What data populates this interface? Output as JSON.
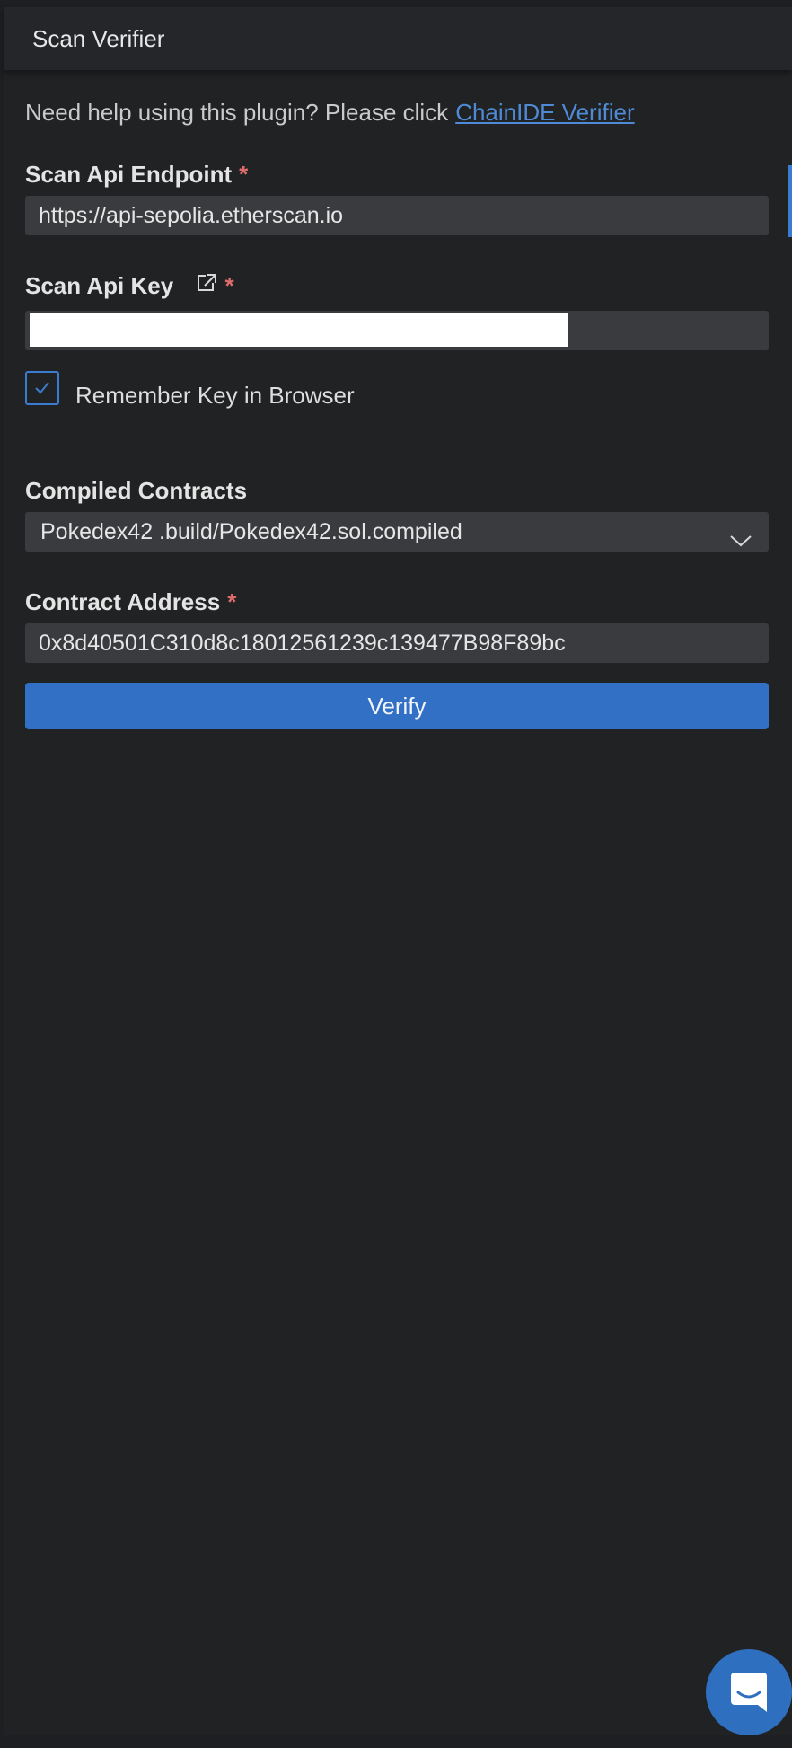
{
  "header": {
    "title": "Scan Verifier"
  },
  "help": {
    "text": "Need help using this plugin? Please click",
    "link_label": "ChainIDE Verifier"
  },
  "endpoint": {
    "label": "Scan Api Endpoint",
    "required_mark": "*",
    "value": "https://api-sepolia.etherscan.io"
  },
  "api_key": {
    "label": "Scan Api Key",
    "required_mark": "*",
    "external_icon": "external-link-icon",
    "value_masked": true
  },
  "remember": {
    "label": "Remember Key in Browser",
    "checked": true
  },
  "contracts": {
    "label": "Compiled Contracts",
    "selected": "Pokedex42 .build/Pokedex42.sol.compiled",
    "chevron_icon": "chevron-down-icon"
  },
  "address": {
    "label": "Contract Address",
    "required_mark": "*",
    "value": "0x8d40501C310d8c18012561239c139477B98F89bc"
  },
  "verify_button": {
    "label": "Verify"
  },
  "chat": {
    "icon": "chat-bubble-icon"
  },
  "colors": {
    "accent": "#3170c4",
    "link": "#4f8ad6",
    "required": "#e06c6c",
    "background": "#212224"
  }
}
